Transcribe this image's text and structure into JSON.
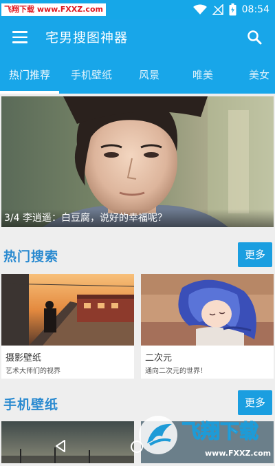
{
  "status_bar": {
    "watermark": "飞翔下载 www.FXXZ.com",
    "time": "08:54"
  },
  "app_bar": {
    "title": "宅男搜图神器",
    "menu_icon": "menu-icon",
    "search_icon": "search-icon"
  },
  "tabs": [
    {
      "label": "热门推荐",
      "active": true
    },
    {
      "label": "手机壁纸",
      "active": false
    },
    {
      "label": "风景",
      "active": false
    },
    {
      "label": "唯美",
      "active": false
    },
    {
      "label": "美女",
      "active": false
    }
  ],
  "banner": {
    "caption": "3/4  李逍遥：白豆腐，说好的幸福呢？"
  },
  "hot_search": {
    "title": "热门搜索",
    "more_label": "更多",
    "cards": [
      {
        "title": "摄影壁纸",
        "subtitle": "艺术大师们的视界"
      },
      {
        "title": "二次元",
        "subtitle": "通向二次元的世界！"
      }
    ]
  },
  "phone_wallpaper": {
    "title": "手机壁纸",
    "more_label": "更多"
  },
  "watermark_br": {
    "brand": "飞翔下载",
    "url": "www.FXXZ.com"
  },
  "colors": {
    "primary": "#18a6e9",
    "section_title": "#2a8ad0",
    "more_button": "#1a9ee0"
  }
}
